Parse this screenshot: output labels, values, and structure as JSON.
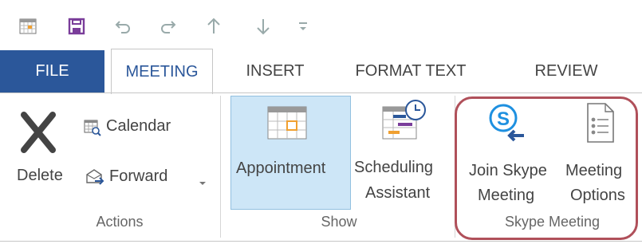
{
  "quick_access": {
    "icons": [
      "calendar-icon",
      "save-icon",
      "undo-icon",
      "redo-icon",
      "up-arrow-icon",
      "down-arrow-icon",
      "customize-icon"
    ]
  },
  "tabs": [
    {
      "label": "FILE"
    },
    {
      "label": "MEETING"
    },
    {
      "label": "INSERT"
    },
    {
      "label": "FORMAT TEXT"
    },
    {
      "label": "REVIEW"
    }
  ],
  "groups": {
    "actions": {
      "label": "Actions",
      "delete": "Delete",
      "calendar": "Calendar",
      "forward": "Forward"
    },
    "show": {
      "label": "Show",
      "appointment": "Appointment",
      "scheduling_1": "Scheduling",
      "scheduling_2": "Assistant"
    },
    "skype": {
      "label": "Skype Meeting",
      "join_1": "Join Skype",
      "join_2": "Meeting",
      "options_1": "Meeting",
      "options_2": "Options"
    }
  },
  "colors": {
    "file_tab": "#2b579a",
    "accent": "#2b579a",
    "selected_button": "#cde6f7",
    "highlight_ring": "#b0505a"
  }
}
